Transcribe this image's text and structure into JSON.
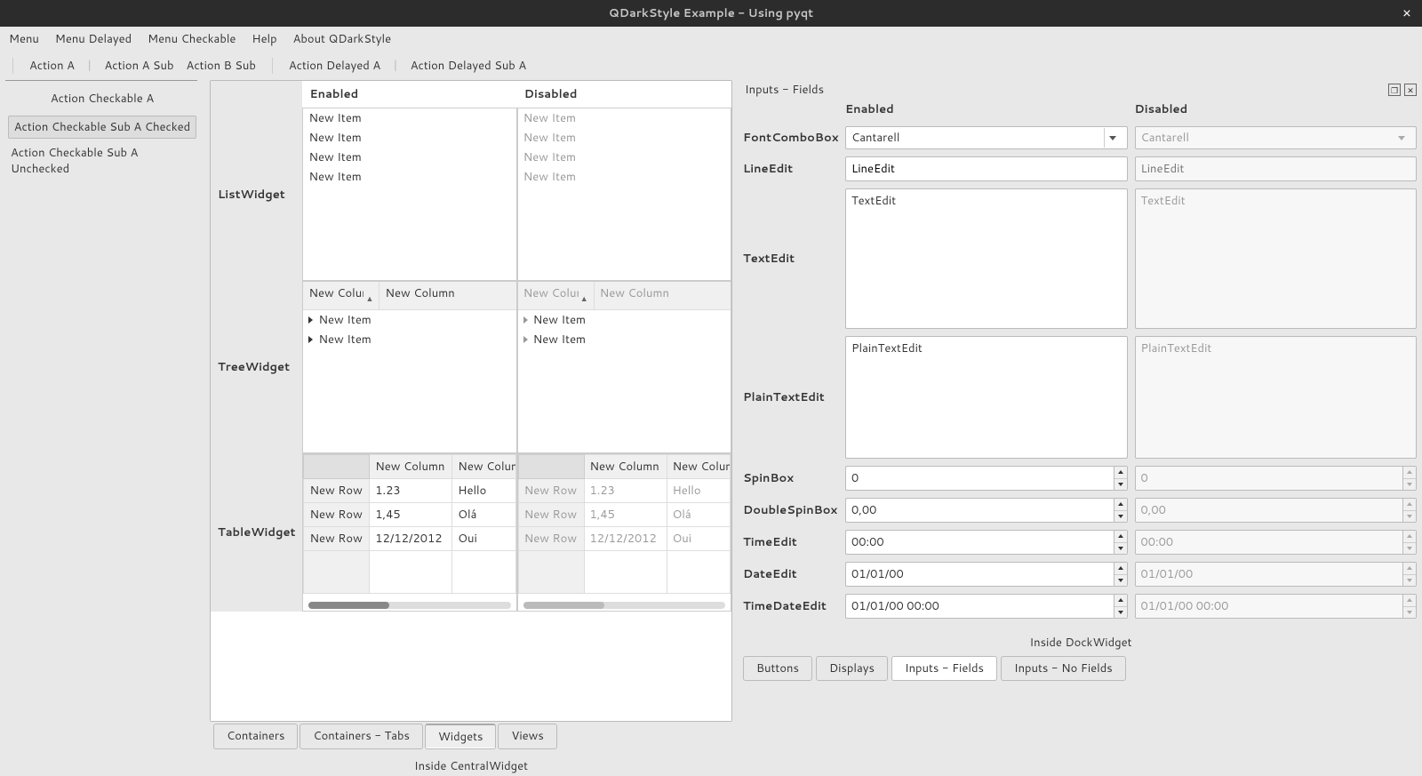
{
  "titlebar": {
    "title": "QDarkStyle Example - Using pyqt",
    "close_icon": "×"
  },
  "menubar": {
    "items": [
      "Menu",
      "Menu Delayed",
      "Menu Checkable",
      "Help",
      "About QDarkStyle"
    ]
  },
  "toolbar": {
    "groups": [
      [
        "Action A",
        "Action A Sub",
        "Action B Sub"
      ],
      [
        "Action Delayed A",
        "Action Delayed Sub A"
      ]
    ]
  },
  "leftcol": {
    "heading": "Action Checkable A",
    "items": [
      {
        "label": "Action Checkable Sub A Checked",
        "checked": true
      },
      {
        "label": "Action Checkable Sub A Unchecked",
        "checked": false
      }
    ]
  },
  "central": {
    "headers": {
      "enabled": "Enabled",
      "disabled": "Disabled"
    },
    "list": {
      "label": "ListWidget",
      "items": [
        "New Item",
        "New Item",
        "New Item",
        "New Item"
      ]
    },
    "tree": {
      "label": "TreeWidget",
      "columns": [
        "New Column",
        "New Column"
      ],
      "items": [
        "New Item",
        "New Item"
      ]
    },
    "table": {
      "label": "TableWidget",
      "columns": [
        "New Column",
        "New Column"
      ],
      "rows": [
        {
          "h": "New Row",
          "c": [
            "1.23",
            "Hello"
          ]
        },
        {
          "h": "New Row",
          "c": [
            "1,45",
            "Olá"
          ]
        },
        {
          "h": "New Row",
          "c": [
            "12/12/2012",
            "Oui"
          ]
        }
      ]
    },
    "tabs": [
      "Containers",
      "Containers - Tabs",
      "Widgets",
      "Views"
    ],
    "active_tab": 2,
    "footer": "Inside CentralWidget"
  },
  "dock": {
    "title": "Inputs - Fields",
    "headers": {
      "enabled": "Enabled",
      "disabled": "Disabled"
    },
    "fields": {
      "font": {
        "label": "FontComboBox",
        "value": "Cantarell"
      },
      "line": {
        "label": "LineEdit",
        "value": "LineEdit",
        "placeholder": "LineEdit"
      },
      "text": {
        "label": "TextEdit",
        "value": "TextEdit",
        "placeholder": "TextEdit"
      },
      "plain": {
        "label": "PlainTextEdit",
        "value": "PlainTextEdit",
        "placeholder": "PlainTextEdit"
      },
      "spin": {
        "label": "SpinBox",
        "value": "0"
      },
      "dspin": {
        "label": "DoubleSpinBox",
        "value": "0,00"
      },
      "time": {
        "label": "TimeEdit",
        "value": "00:00"
      },
      "date": {
        "label": "DateEdit",
        "value": "01/01/00"
      },
      "dtime": {
        "label": "TimeDateEdit",
        "value": "01/01/00 00:00"
      }
    },
    "footer": "Inside DockWidget",
    "tabs": [
      "Buttons",
      "Displays",
      "Inputs - Fields",
      "Inputs - No Fields"
    ],
    "active_tab": 2
  }
}
